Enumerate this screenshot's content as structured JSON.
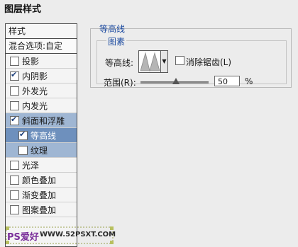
{
  "window": {
    "title": "图层样式"
  },
  "sidebar": {
    "header": "样式",
    "blend": "混合选项:自定",
    "items": [
      {
        "label": "投影",
        "checked": false
      },
      {
        "label": "内阴影",
        "checked": true
      },
      {
        "label": "外发光",
        "checked": false
      },
      {
        "label": "内发光",
        "checked": false
      },
      {
        "label": "斜面和浮雕",
        "checked": true,
        "selected": true
      },
      {
        "label": "等高线",
        "checked": true,
        "sub": true,
        "current": true
      },
      {
        "label": "纹理",
        "checked": false,
        "sub": true
      },
      {
        "label": "光泽",
        "checked": false
      },
      {
        "label": "颜色叠加",
        "checked": false
      },
      {
        "label": "渐变叠加",
        "checked": false
      },
      {
        "label": "图案叠加",
        "checked": false
      }
    ]
  },
  "panel": {
    "section_title": "等高线",
    "group_title": "图素",
    "contour_label": "等高线:",
    "antialias_label": "消除锯齿(L)",
    "antialias_checked": false,
    "range_label": "范围(R):",
    "range_value": "50",
    "range_unit": "%",
    "range_slider_level": 0.5
  },
  "watermark": {
    "ps": "PS爱好",
    "url": "WWW.52PSXT.COM"
  }
}
